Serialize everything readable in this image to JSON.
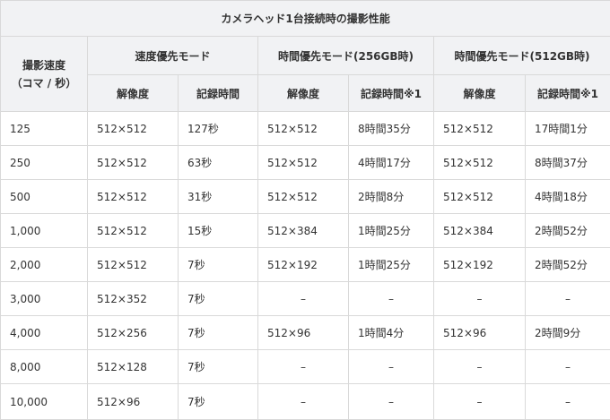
{
  "table": {
    "title": "カメラヘッド1台接続時の撮影性能",
    "header": {
      "speed_line1": "撮影速度",
      "speed_line2": "（コマ / 秒）",
      "groups": [
        "速度優先モード",
        "時間優先モード(256GB時)",
        "時間優先モード(512GB時)"
      ],
      "subheaders": [
        "解像度",
        "記録時間",
        "解像度",
        "記録時間※1",
        "解像度",
        "記録時間※1"
      ]
    },
    "rows": [
      [
        "125",
        "512×512",
        "127秒",
        "512×512",
        "8時間35分",
        "512×512",
        "17時間1分"
      ],
      [
        "250",
        "512×512",
        "63秒",
        "512×512",
        "4時間17分",
        "512×512",
        "8時間37分"
      ],
      [
        "500",
        "512×512",
        "31秒",
        "512×512",
        "2時間8分",
        "512×512",
        "4時間18分"
      ],
      [
        "1,000",
        "512×512",
        "15秒",
        "512×384",
        "1時間25分",
        "512×384",
        "2時間52分"
      ],
      [
        "2,000",
        "512×512",
        "7秒",
        "512×192",
        "1時間25分",
        "512×192",
        "2時間52分"
      ],
      [
        "3,000",
        "512×352",
        "7秒",
        "–",
        "–",
        "–",
        "–"
      ],
      [
        "4,000",
        "512×256",
        "7秒",
        "512×96",
        "1時間4分",
        "512×96",
        "2時間9分"
      ],
      [
        "8,000",
        "512×128",
        "7秒",
        "–",
        "–",
        "–",
        "–"
      ],
      [
        "10,000",
        "512×96",
        "7秒",
        "–",
        "–",
        "–",
        "–"
      ]
    ]
  }
}
